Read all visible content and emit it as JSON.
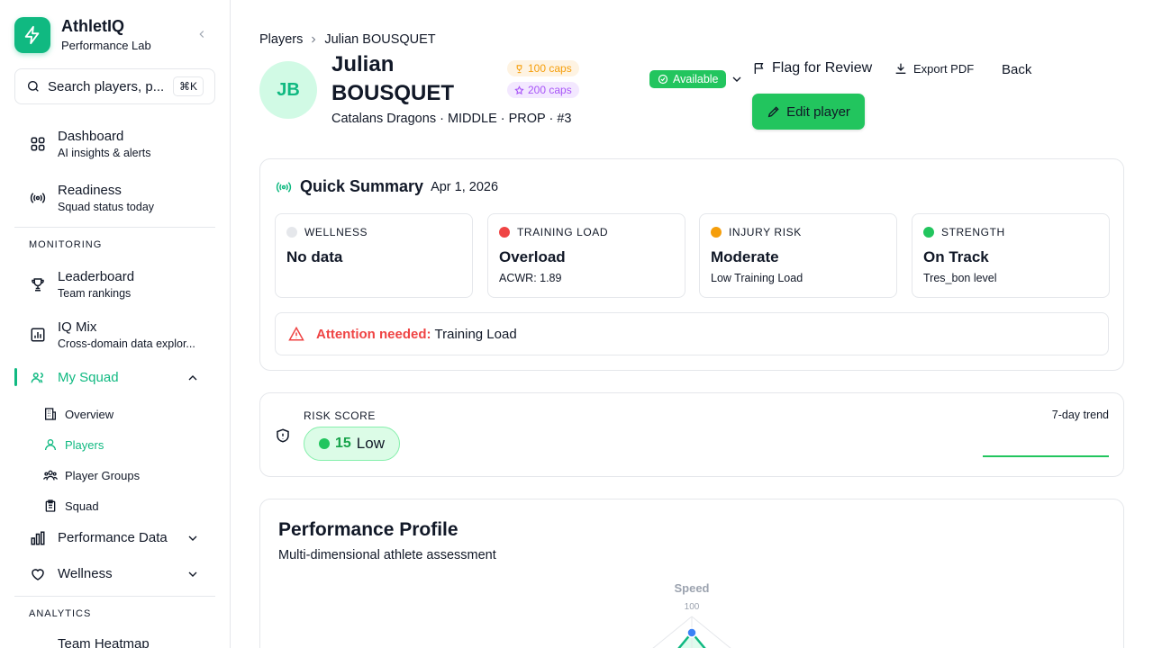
{
  "brand": {
    "name": "AthletIQ",
    "subtitle": "Performance Lab"
  },
  "search": {
    "placeholder": "Search players, p...",
    "shortcut": "⌘K"
  },
  "nav": {
    "dashboard": {
      "title": "Dashboard",
      "sub": "AI insights & alerts"
    },
    "readiness": {
      "title": "Readiness",
      "sub": "Squad status today"
    },
    "monitoring_label": "MONITORING",
    "leaderboard": {
      "title": "Leaderboard",
      "sub": "Team rankings"
    },
    "iqmix": {
      "title": "IQ Mix",
      "sub": "Cross-domain data explor..."
    },
    "mysquad": {
      "title": "My Squad"
    },
    "sub_items": {
      "overview": "Overview",
      "players": "Players",
      "groups": "Player Groups",
      "squad": "Squad"
    },
    "perfdata": {
      "title": "Performance Data"
    },
    "wellness": {
      "title": "Wellness"
    },
    "analytics_label": "ANALYTICS",
    "heatmap": {
      "title": "Team Heatmap"
    }
  },
  "colors": {
    "accent": "#10b981",
    "success": "#22c55e",
    "danger": "#ef4444",
    "warning": "#f59e0b",
    "purple": "#a855f7"
  },
  "breadcrumb": {
    "parent": "Players",
    "current": "Julian BOUSQUET"
  },
  "player": {
    "initials": "JB",
    "name": "Julian BOUSQUET",
    "meta": "Catalans Dragons · MIDDLE · PROP · #3",
    "caps_gold": "100 caps",
    "caps_purple": "200 caps",
    "status": "Available"
  },
  "actions": {
    "flag": "Flag for Review",
    "export": "Export PDF",
    "back": "Back",
    "edit": "Edit player"
  },
  "summary": {
    "title": "Quick Summary",
    "date": "Apr 1, 2026",
    "metrics": [
      {
        "label": "WELLNESS",
        "value": "No data",
        "sub": "",
        "color": "#e5e7eb"
      },
      {
        "label": "TRAINING LOAD",
        "value": "Overload",
        "sub": "ACWR: 1.89",
        "color": "#ef4444"
      },
      {
        "label": "INJURY RISK",
        "value": "Moderate",
        "sub": "Low Training Load",
        "color": "#f59e0b"
      },
      {
        "label": "STRENGTH",
        "value": "On Track",
        "sub": "Tres_bon level",
        "color": "#22c55e"
      }
    ],
    "alert_label": "Attention needed:",
    "alert_text": "Training Load"
  },
  "risk": {
    "label": "RISK SCORE",
    "score": "15",
    "level": "Low",
    "trend_label": "7-day trend"
  },
  "performance": {
    "title": "Performance Profile",
    "subtitle": "Multi-dimensional athlete assessment",
    "radar_axis_top": "Speed",
    "radar_tick": "100"
  }
}
